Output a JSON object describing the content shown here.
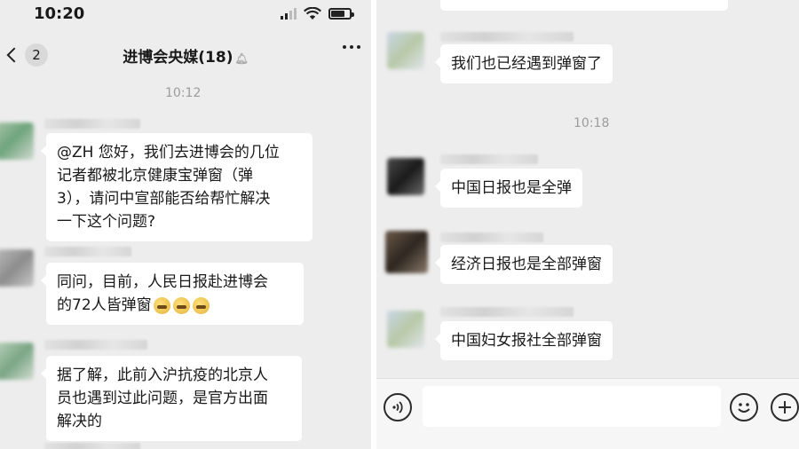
{
  "status_bar": {
    "time": "10:20"
  },
  "nav": {
    "back_count": "2",
    "title": "进博会央媒(18)"
  },
  "left_chat": {
    "time_separator": "10:12",
    "messages": [
      {
        "lines": [
          "@ZH 您好，我们去进博会的几位",
          "记者都被北京健康宝弹窗（弹",
          "3），请问中宣部能否给帮忙解决",
          "一下这个问题?"
        ]
      },
      {
        "lines": [
          "同问，目前，人民日报赴进博会",
          "的72人皆弹窗"
        ],
        "emoji": [
          "face-emoji",
          "face-emoji",
          "face-emoji"
        ]
      },
      {
        "lines": [
          "据了解，此前入沪抗疫的北京人",
          "员也遇到过此问题，是官方出面",
          "解决的"
        ]
      }
    ]
  },
  "right_chat": {
    "messages_before": [
      {
        "text": "我们也已经遇到弹窗了"
      }
    ],
    "time_separator": "10:18",
    "messages_after": [
      {
        "text": "中国日报也是全弹"
      },
      {
        "text": "经济日报也是全部弹窗"
      },
      {
        "text": "中国妇女报社全部弹窗"
      }
    ]
  },
  "input_bar": {
    "value": ""
  },
  "icons": {
    "signal": "signal-icon",
    "wifi": "wifi-icon",
    "battery": "battery-icon",
    "back": "chevron-left-icon",
    "more": "more-icon",
    "mute": "mute-bell-icon",
    "voice": "voice-icon",
    "emoji": "emoji-icon",
    "plus": "plus-icon"
  }
}
